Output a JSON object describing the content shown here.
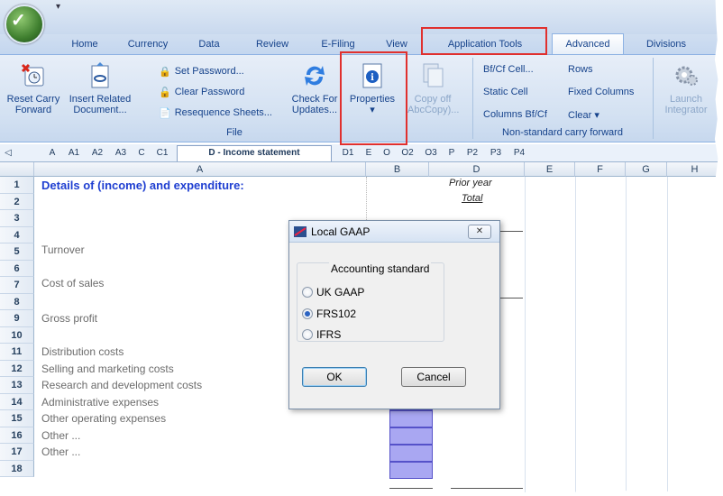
{
  "ribbon": {
    "tabs": [
      "Home",
      "Currency",
      "Data",
      "Review",
      "E-Filing",
      "View",
      "Application Tools",
      "Advanced",
      "Divisions"
    ],
    "active_tab": "Advanced",
    "file_group": {
      "label": "File",
      "reset_carry_forward": "Reset Carry Forward",
      "reset_line1": "Reset Carry",
      "reset_line2": "Forward",
      "insert_line1": "Insert Related",
      "insert_line2": "Document...",
      "set_password": "Set Password...",
      "clear_password": "Clear Password",
      "resequence_sheets": "Resequence Sheets...",
      "check_line1": "Check For",
      "check_line2": "Updates...",
      "properties": "Properties",
      "copy_line1": "Copy off",
      "copy_line2": "AbcCopy)..."
    },
    "ncf_group": {
      "label": "Non-standard carry forward",
      "bfcf_cell": "Bf/Cf Cell...",
      "static_cell": "Static Cell",
      "columns_bfcf": "Columns Bf/Cf",
      "rows": "Rows",
      "fixed_columns": "Fixed Columns",
      "clear": "Clear ▾"
    },
    "launch_line1": "Launch",
    "launch_line2": "Integrator"
  },
  "sheet_tabs": [
    "A",
    "A1",
    "A2",
    "A3",
    "C",
    "C1",
    "D - Income statement",
    "D1",
    "E",
    "O",
    "O2",
    "O3",
    "P",
    "P2",
    "P3",
    "P4"
  ],
  "active_sheet": "D - Income statement",
  "columns": [
    "A",
    "B",
    "D",
    "E",
    "F",
    "G",
    "H"
  ],
  "rows": [
    "1",
    "2",
    "3",
    "4",
    "5",
    "6",
    "7",
    "8",
    "9",
    "10",
    "11",
    "12",
    "13",
    "14",
    "15",
    "16",
    "17",
    "18"
  ],
  "cells": {
    "title": "Details of (income) and expenditure:",
    "prior_year": "Prior year",
    "total": "Total",
    "turnover": "Turnover",
    "cost_of_sales": "Cost of sales",
    "gross_profit": "Gross profit",
    "distribution": "Distribution costs",
    "selling": "Selling and marketing costs",
    "research": "Research and development costs",
    "admin": "Administrative expenses",
    "other_op": "Other operating expenses",
    "other1": "Other ...",
    "other2": "Other ..."
  },
  "dialog": {
    "title": "Local GAAP",
    "group_label": "Accounting standard",
    "options": [
      "UK GAAP",
      "FRS102",
      "IFRS"
    ],
    "selected": "FRS102",
    "ok": "OK",
    "cancel": "Cancel",
    "close": "✕"
  },
  "colors": {
    "accent_red": "#e0302e",
    "title_blue": "#1f3fd1",
    "highlight_cell": "#a9a7f2"
  }
}
